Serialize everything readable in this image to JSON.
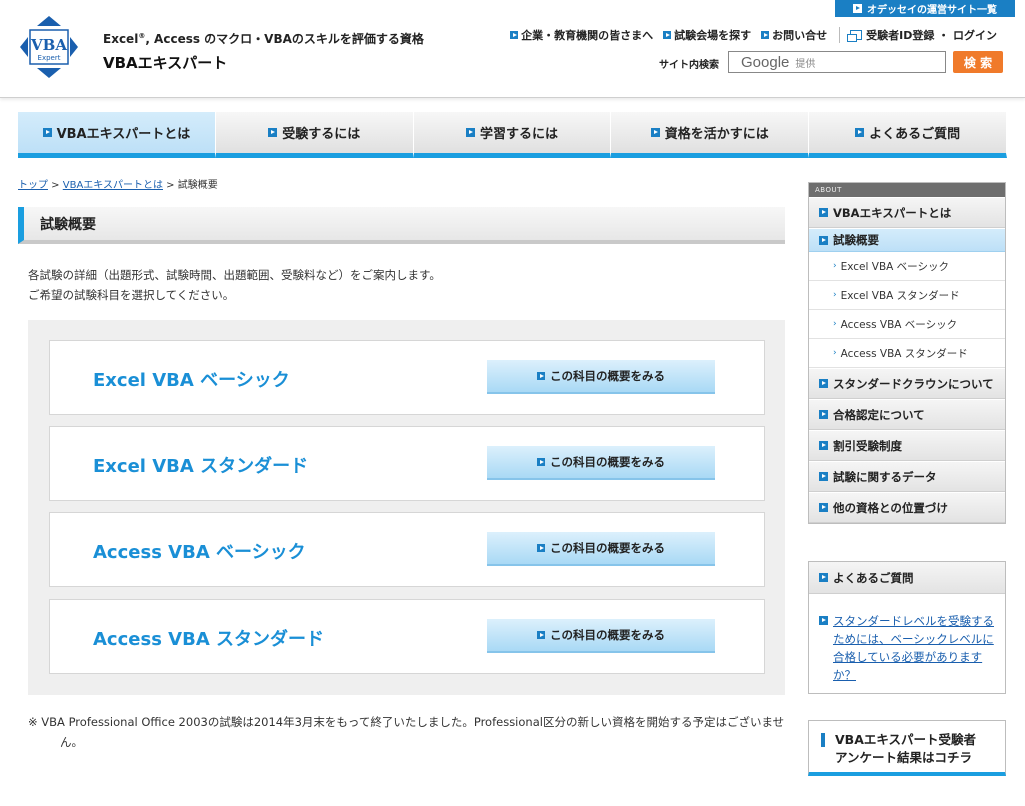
{
  "header": {
    "logo_text": "VBA",
    "logo_sub": "Expert",
    "tagline_pre": "Excel",
    "tagline_reg": "®",
    "tagline_post": ", Access のマクロ・VBAのスキルを評価する資格",
    "brand": "VBAエキスパート",
    "odyssey_link": "オデッセイの運営サイト一覧",
    "top_links": [
      "企業・教育機関の皆さまへ",
      "試験会場を探す",
      "お問い合せ"
    ],
    "register_link": "受験者ID登録 ・ ログイン",
    "search_label": "サイト内検索",
    "search_google": "Google",
    "search_provided": "提供",
    "search_button": "検 索"
  },
  "nav": [
    "VBAエキスパートとは",
    "受験するには",
    "学習するには",
    "資格を活かすには",
    "よくあるご質問"
  ],
  "breadcrumb": {
    "home": "トップ",
    "sep1": " > ",
    "parent": "VBAエキスパートとは",
    "sep2": " > ",
    "current": "試験概要"
  },
  "page_title": "試験概要",
  "intro": [
    "各試験の詳細（出題形式、試験時間、出題範囲、受験料など）をご案内します。",
    "ご希望の試験科目を選択してください。"
  ],
  "exams": [
    {
      "name": "Excel VBA ベーシック",
      "button": "この科目の概要をみる"
    },
    {
      "name": "Excel VBA スタンダード",
      "button": "この科目の概要をみる"
    },
    {
      "name": "Access VBA ベーシック",
      "button": "この科目の概要をみる"
    },
    {
      "name": "Access VBA スタンダード",
      "button": "この科目の概要をみる"
    }
  ],
  "note": "※ VBA Professional Office 2003の試験は2014年3月末をもって終了いたしました。Professional区分の新しい資格を開始する予定はございません。",
  "sidebar": {
    "about_head": "ABOUT",
    "items_top": [
      "VBAエキスパートとは",
      "試験概要"
    ],
    "sub_items": [
      "Excel VBA ベーシック",
      "Excel VBA スタンダード",
      "Access VBA ベーシック",
      "Access VBA スタンダード"
    ],
    "items_bottom": [
      "スタンダードクラウンについて",
      "合格認定について",
      "割引受験制度",
      "試験に関するデータ",
      "他の資格との位置づけ"
    ],
    "faq_head": "よくあるご質問",
    "faq_question": "スタンダードレベルを受験するためには、ベーシックレベルに合格している必要がありますか？",
    "survey_line1": "VBAエキスパート受験者",
    "survey_line2": "アンケート結果はコチラ"
  },
  "colors": {
    "accent": "#1a9ee0",
    "link": "#1a5fae",
    "search_button": "#f07a2a",
    "exam_name": "#1a8fd6"
  }
}
